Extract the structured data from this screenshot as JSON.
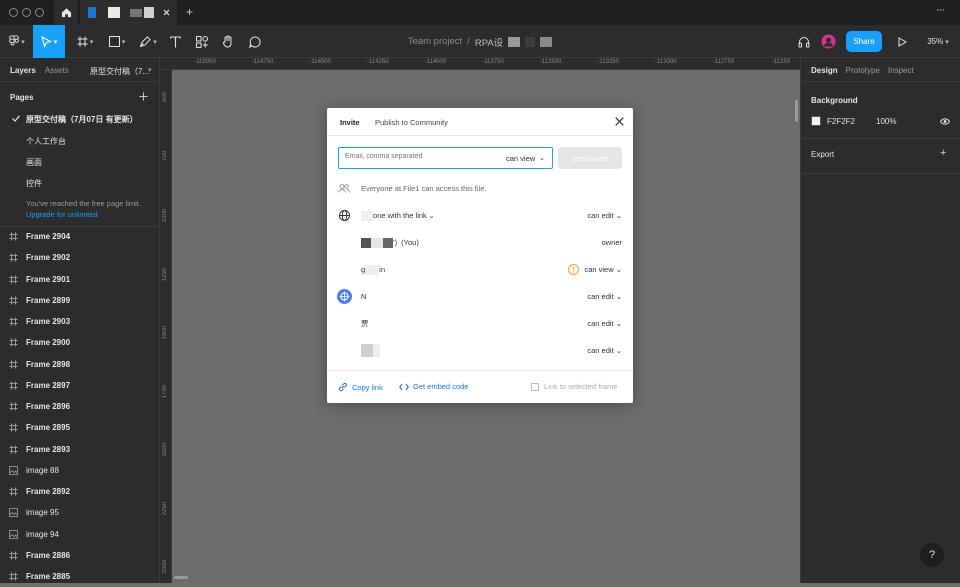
{
  "titlebar": {
    "new_tab_label": "+",
    "more_label": "···"
  },
  "toolbar": {
    "breadcrumb": {
      "project": "Team project",
      "separator": "/",
      "file_name": "RPA设"
    },
    "share_label": "Share",
    "zoom_label": "35%"
  },
  "left_panel": {
    "tabs": [
      {
        "label": "Layers"
      },
      {
        "label": "Assets"
      }
    ],
    "file_title": "原型交付稿（7...",
    "pages_heading": "Pages",
    "pages": [
      {
        "label": "原型交付稿（7月07日 有更新）",
        "selected": true
      },
      {
        "label": "个人工作台"
      },
      {
        "label": "画面"
      },
      {
        "label": "控件"
      }
    ],
    "limit_note": "You've reached the free page limit.",
    "upgrade_link": "Upgrade for unlimited",
    "layers": [
      {
        "label": "Frame 2904",
        "icon": "frame-icon"
      },
      {
        "label": "Frame 2902",
        "icon": "frame-icon"
      },
      {
        "label": "Frame 2901",
        "icon": "frame-icon"
      },
      {
        "label": "Frame 2899",
        "icon": "frame-icon"
      },
      {
        "label": "Frame 2903",
        "icon": "frame-icon"
      },
      {
        "label": "Frame 2900",
        "icon": "frame-icon"
      },
      {
        "label": "Frame 2898",
        "icon": "frame-icon"
      },
      {
        "label": "Frame 2897",
        "icon": "frame-icon"
      },
      {
        "label": "Frame 2896",
        "icon": "frame-icon"
      },
      {
        "label": "Frame 2895",
        "icon": "frame-icon"
      },
      {
        "label": "Frame 2893",
        "icon": "frame-icon"
      },
      {
        "label": "image 88",
        "icon": "image-icon"
      },
      {
        "label": "Frame 2892",
        "icon": "frame-icon"
      },
      {
        "label": "image 95",
        "icon": "image-icon"
      },
      {
        "label": "image 94",
        "icon": "image-icon"
      },
      {
        "label": "Frame 2886",
        "icon": "frame-icon"
      },
      {
        "label": "Frame 2885",
        "icon": "frame-icon"
      }
    ]
  },
  "rulers": {
    "horizontal": [
      "-115000",
      "-114750",
      "-114500",
      "-114250",
      "-114000",
      "-113750",
      "-113500",
      "-113250",
      "-113000",
      "-112750",
      "-11250"
    ],
    "vertical": [
      "500",
      "750",
      "1000",
      "1250",
      "1500",
      "1750",
      "2000",
      "2250",
      "2500"
    ]
  },
  "right_panel": {
    "tabs": [
      {
        "label": "Design"
      },
      {
        "label": "Prototype"
      },
      {
        "label": "Inspect"
      }
    ],
    "background_heading": "Background",
    "background_hex": "F2F2F2",
    "background_opacity": "100%",
    "export_heading": "Export",
    "add_label": "+"
  },
  "modal": {
    "tabs": [
      {
        "label": "Invite"
      },
      {
        "label": "Publish to Community"
      }
    ],
    "email_placeholder": "Email, comma separated",
    "invite_role": "can view",
    "send_label": "Send invite",
    "access_note": "Everyone at File1 can access this file.",
    "members": [
      {
        "name": "one with the link",
        "role": "can edit",
        "icon": "globe-icon"
      },
      {
        "name": "(You)",
        "role": "owner",
        "icon": ""
      },
      {
        "name": "g",
        "name_tail": "in",
        "role": "can view",
        "icon": "warning-icon"
      },
      {
        "name": "N",
        "role": "can edit",
        "icon": "team-icon"
      },
      {
        "name": "贾",
        "role": "can edit",
        "icon": ""
      },
      {
        "name": "",
        "role": "can edit",
        "icon": ""
      }
    ],
    "copy_link_label": "Copy link",
    "embed_label": "Get embed code",
    "link_frame_label": "Link to selected frame"
  },
  "help_label": "?",
  "colors": {
    "accent": "#18a0fb",
    "panel": "#2c2c2c",
    "titlebar": "#1f1f1f",
    "canvas_dimmed": "#6c6c6c",
    "link_blue": "#1b76d6",
    "warning": "#f5a623"
  }
}
